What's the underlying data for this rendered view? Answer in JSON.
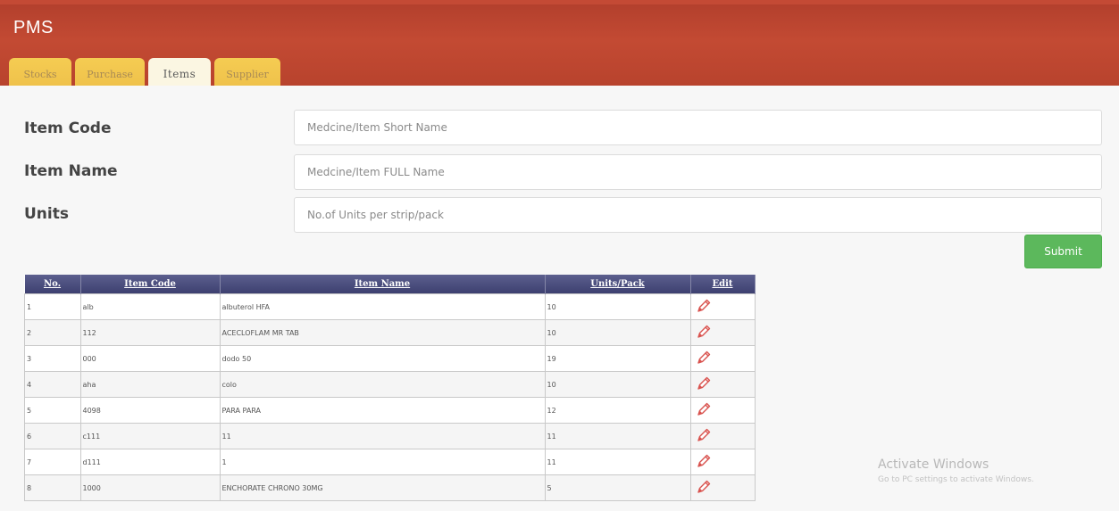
{
  "app": {
    "title": "PMS"
  },
  "tabs": [
    {
      "label": "Stocks",
      "active": false
    },
    {
      "label": "Purchase",
      "active": false
    },
    {
      "label": "Items",
      "active": true
    },
    {
      "label": "Supplier",
      "active": false
    }
  ],
  "form": {
    "item_code": {
      "label": "Item Code",
      "placeholder": "Medcine/Item Short Name",
      "value": ""
    },
    "item_name": {
      "label": "Item Name",
      "placeholder": "Medcine/Item FULL Name",
      "value": ""
    },
    "units": {
      "label": "Units",
      "placeholder": "No.of Units per strip/pack",
      "value": ""
    },
    "submit_label": "Submit"
  },
  "table": {
    "headers": {
      "no": "No.",
      "code": "Item Code",
      "name": "Item Name",
      "units": "Units/Pack",
      "edit": "Edit"
    },
    "rows": [
      {
        "no": "1",
        "code": "alb",
        "name": "albuterol HFA",
        "units": "10"
      },
      {
        "no": "2",
        "code": "112",
        "name": "ACECLOFLAM MR TAB",
        "units": "10"
      },
      {
        "no": "3",
        "code": "000",
        "name": "dodo 50",
        "units": "19"
      },
      {
        "no": "4",
        "code": "aha",
        "name": "colo",
        "units": "10"
      },
      {
        "no": "5",
        "code": "4098",
        "name": "PARA PARA",
        "units": "12"
      },
      {
        "no": "6",
        "code": "c111",
        "name": "11",
        "units": "11"
      },
      {
        "no": "7",
        "code": "d111",
        "name": "1",
        "units": "11"
      },
      {
        "no": "8",
        "code": "1000",
        "name": "ENCHORATE CHRONO 30MG",
        "units": "5"
      }
    ],
    "edit_icon": "pencil-icon",
    "edit_icon_color": "#d9534f"
  },
  "watermark": {
    "title": "Activate Windows",
    "subtitle": "Go to PC settings to activate Windows."
  },
  "colors": {
    "header_bg": "#c0462f",
    "tab_bg": "#f2c44e",
    "tab_active_bg": "#fbf6e2",
    "table_header_bg": "#4a4d7c",
    "submit_bg": "#5cb85c"
  }
}
